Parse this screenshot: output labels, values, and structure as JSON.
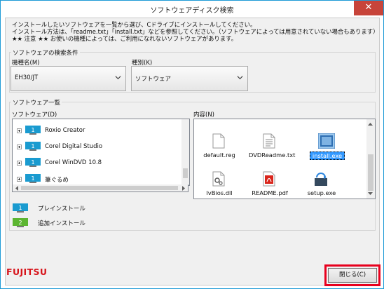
{
  "window": {
    "title": "ソフトウェアディスク検索",
    "close_glyph": "✕"
  },
  "instructions": [
    "インストールしたいソフトウェアを一覧から選び、Cドライブにインストールしてください。",
    "インストール方法は、「readme.txt」「install.txt」などを参照してください。（ソフトウェアによっては用意されていない場合もあります）",
    "★★ 注意 ★★ お使いの機種によっては、ご利用になれないソフトウェアがあります。"
  ],
  "search_conditions": {
    "group_label": "ソフトウェアの検索条件",
    "model_label": "機種名(M)",
    "model_value": "EH30/JT",
    "type_label": "種別(K)",
    "type_value": "ソフトウェア"
  },
  "software_list": {
    "group_label": "ソフトウェア一覧",
    "tree_label": "ソフトウェア(D)",
    "items": [
      {
        "label": "Roxio Creator",
        "install_type": "preinstall"
      },
      {
        "label": "Corel Digital Studio",
        "install_type": "preinstall"
      },
      {
        "label": "Corel WinDVD 10.8",
        "install_type": "preinstall"
      },
      {
        "label": "筆ぐるめ",
        "install_type": "preinstall"
      }
    ],
    "contents_label": "内容(N)",
    "files": [
      {
        "name": "default.reg",
        "icon": "reg-file-icon",
        "selected": false
      },
      {
        "name": "DVDReadme.txt",
        "icon": "text-file-icon",
        "selected": false
      },
      {
        "name": "install.exe",
        "icon": "exe-file-icon",
        "selected": true
      },
      {
        "name": "IvBios.dll",
        "icon": "dll-file-icon",
        "selected": false
      },
      {
        "name": "README.pdf",
        "icon": "pdf-file-icon",
        "selected": false
      },
      {
        "name": "setup.exe",
        "icon": "setup-icon",
        "selected": false
      }
    ]
  },
  "legend": [
    {
      "chip_number": "1",
      "label": "プレインストール",
      "color": "#1a9bd0"
    },
    {
      "chip_number": "2",
      "label": "追加インストール",
      "color": "#5cb531"
    }
  ],
  "footer": {
    "brand": "FUJITSU",
    "close_button_label": "閉じる(C)"
  },
  "colors": {
    "accent": "#1e9bd6",
    "highlight": "#e8001e",
    "brand_red": "#d7141b",
    "selection": "#3399ff"
  }
}
